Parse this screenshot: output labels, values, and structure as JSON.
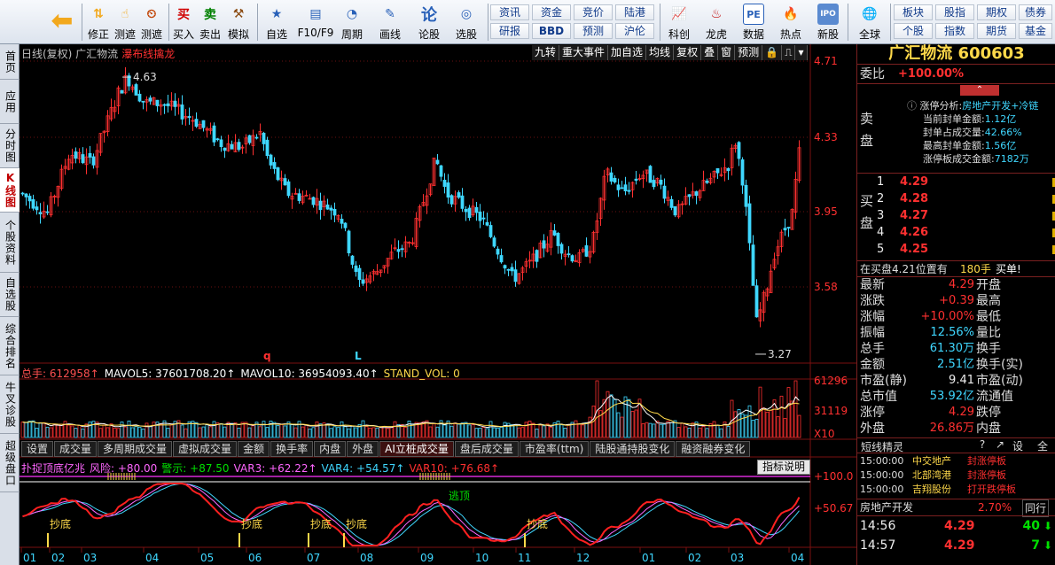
{
  "toolbar": {
    "buttons": [
      {
        "icon": "home-grid-icon",
        "label": ""
      },
      {
        "icon": "back-arrow-icon",
        "label": ""
      },
      {
        "icon": "up-down-arrow-icon",
        "label": "修正"
      },
      {
        "icon": "hand-icon",
        "label": "测遮"
      },
      {
        "icon": "clock-icon",
        "label": "测遮"
      },
      {
        "icon": "buy-icon",
        "label": "买入",
        "glyph": "买"
      },
      {
        "icon": "sell-icon",
        "label": "卖出",
        "glyph": "卖"
      },
      {
        "icon": "gavel-icon",
        "label": "模拟"
      },
      {
        "icon": "star-icon",
        "label": "自选"
      },
      {
        "icon": "window-icon",
        "label": "F10/F9"
      },
      {
        "icon": "period-icon",
        "label": "周期"
      },
      {
        "icon": "pencil-icon",
        "label": "画线"
      },
      {
        "icon": "lun-icon",
        "label": "论股",
        "glyph": "论"
      },
      {
        "icon": "select-icon",
        "label": "选股"
      }
    ],
    "grid1": [
      "资讯",
      "资金",
      "竞价",
      "陆港",
      "研报",
      "BBD",
      "预测",
      "沪伦"
    ],
    "buttons2": [
      {
        "icon": "chart-icon",
        "label": "科创"
      },
      {
        "icon": "dragon-icon",
        "label": "龙虎"
      },
      {
        "icon": "pe-icon",
        "label": "数据",
        "glyph": "PE"
      },
      {
        "icon": "hot-icon",
        "label": "热点"
      },
      {
        "icon": "ipo-icon",
        "label": "新股",
        "glyph": "IPO"
      },
      {
        "icon": "globe-icon",
        "label": "全球"
      }
    ],
    "grid2": [
      "板块",
      "股指",
      "期权",
      "债券",
      "个股",
      "指数",
      "期货",
      "基金"
    ]
  },
  "left_tabs": [
    "首页",
    "应用",
    "分时图",
    "K线图",
    "个股资料",
    "自选股",
    "综合排名",
    "牛叉诊股",
    "超级盘口"
  ],
  "left_tabs_active": 3,
  "main": {
    "header": "日线(复权)  广汇物流",
    "highlight": "瀑布线擒龙",
    "tools": [
      "九转",
      "重大事件",
      "加自选",
      "均线",
      "复权",
      "叠",
      "窗",
      "预测"
    ],
    "price_axis": [
      "4.71",
      "4.33",
      "3.95",
      "3.58"
    ],
    "high_label": "4.63",
    "low_label": "3.27",
    "markers": [
      "q",
      "L"
    ]
  },
  "volume": {
    "header": [
      {
        "text": "总手: 612958↑",
        "color": "#ff5050"
      },
      {
        "text": "MAVOL5: 37601708.20↑",
        "color": "#ffffff"
      },
      {
        "text": "MAVOL10: 36954093.40↑",
        "color": "#ffffff"
      },
      {
        "text": "STAND_VOL: 0",
        "color": "#ffd94a"
      }
    ],
    "axis": [
      "61296",
      "31119",
      "X10"
    ]
  },
  "indicator_tabs": [
    "设置",
    "成交量",
    "多周期成交量",
    "虚拟成交量",
    "金额",
    "换手率",
    "内盘",
    "外盘",
    "AI立桩成交量",
    "盘后成交量",
    "市盈率(ttm)",
    "陆股通持股变化",
    "融资融券变化"
  ],
  "indicator_tabs_active": 8,
  "indicator": {
    "header": [
      {
        "text": "扑捉顶底亿兆",
        "color": "#ff66ff"
      },
      {
        "text": "风险: +80.00",
        "color": "#ff66ff"
      },
      {
        "text": "警示: +87.50",
        "color": "#00e000"
      },
      {
        "text": "VAR3: +62.22↑",
        "color": "#ff66ff"
      },
      {
        "text": "VAR4: +54.57↑",
        "color": "#3fd7ff"
      },
      {
        "text": "VAR10: +76.68↑",
        "color": "#ff3030"
      }
    ],
    "explain_label": "指标说明",
    "axis": [
      "+100.0",
      "+50.67"
    ],
    "buy_label": "抄底",
    "escape_label": "逃顶"
  },
  "date_axis": [
    "01",
    "02",
    "03",
    "04",
    "05",
    "06",
    "07",
    "08",
    "09",
    "10",
    "11",
    "12",
    "01",
    "02",
    "03",
    "04"
  ],
  "quote": {
    "name_code": "广汇物流 600603",
    "weibi_label": "委比",
    "weibi_value": "+100.00%",
    "limit_info": {
      "line1_label": "涨停分析:",
      "line1_value": "房地产开发+冷链",
      "lines": [
        {
          "label": "当前封单金额:",
          "value": "1.12亿"
        },
        {
          "label": "封单占成交量:",
          "value": "42.66%"
        },
        {
          "label": "最高封单金额:",
          "value": "1.56亿"
        },
        {
          "label": "涨停板成交金额:",
          "value": "7182万"
        }
      ]
    },
    "sell_label": "卖盘",
    "buy_label": "买盘",
    "buy_orders": [
      {
        "level": "1",
        "price": "4.29"
      },
      {
        "level": "2",
        "price": "4.28"
      },
      {
        "level": "3",
        "price": "4.27"
      },
      {
        "level": "4",
        "price": "4.26"
      },
      {
        "level": "5",
        "price": "4.25"
      }
    ],
    "queue_text": "在买盘4.21位置有",
    "queue_count": "180手",
    "queue_tag": "买单!",
    "stats": [
      {
        "l": "最新",
        "v": "4.29",
        "vc": "red",
        "r": "开盘"
      },
      {
        "l": "涨跌",
        "v": "+0.39",
        "vc": "red",
        "r": "最高"
      },
      {
        "l": "涨幅",
        "v": "+10.00%",
        "vc": "red",
        "r": "最低"
      },
      {
        "l": "振幅",
        "v": "12.56%",
        "vc": "cyan",
        "r": "量比"
      },
      {
        "l": "总手",
        "v": "61.30万",
        "vc": "cyan",
        "r": "换手"
      },
      {
        "l": "金额",
        "v": "2.51亿",
        "vc": "cyan",
        "r": "换手(实)"
      },
      {
        "l": "市盈(静)",
        "v": "9.41",
        "vc": "white",
        "r": "市盈(动)"
      },
      {
        "l": "总市值",
        "v": "53.92亿",
        "vc": "cyan",
        "r": "流通值"
      },
      {
        "l": "涨停",
        "v": "4.29",
        "vc": "red",
        "r": "跌停"
      },
      {
        "l": "外盘",
        "v": "26.86万",
        "vc": "red",
        "r": "内盘"
      }
    ],
    "short_title": "短线精灵",
    "short_buttons": [
      "?",
      "↗",
      "设",
      "全"
    ],
    "short_rows": [
      {
        "time": "15:00:00",
        "name": "中交地产",
        "event": "封涨停板"
      },
      {
        "time": "15:00:00",
        "name": "北部湾港",
        "event": "封涨停板"
      },
      {
        "time": "15:00:00",
        "name": "吉翔股份",
        "event": "打开跌停板"
      }
    ],
    "sector": {
      "name": "房地产开发",
      "change": "2.70%",
      "tab": "同行"
    },
    "ticks": [
      {
        "time": "14:56",
        "price": "4.29",
        "vol": "40",
        "dir": "down"
      },
      {
        "time": "14:57",
        "price": "4.29",
        "vol": "7",
        "dir": "down"
      }
    ]
  },
  "colors": {
    "up": "#ff3030",
    "down": "#3fd7ff",
    "ma1": "#ffffff",
    "ma2": "#ffd94a",
    "grid": "#7a1010"
  }
}
